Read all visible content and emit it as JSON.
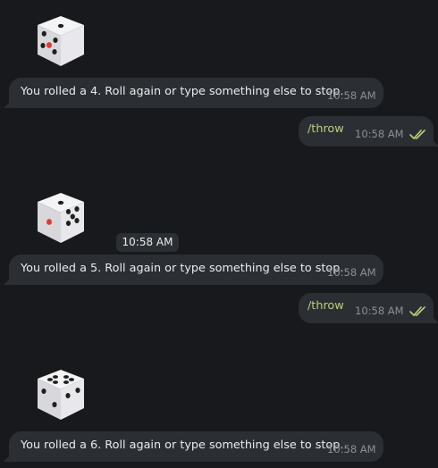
{
  "messages": [
    {
      "type": "dice",
      "face": 4,
      "text": "You rolled a 4. Roll again or type something else to stop.",
      "time": "10:58 AM"
    },
    {
      "type": "command",
      "text": "/throw",
      "time": "10:58 AM",
      "status": "read"
    },
    {
      "type": "dice",
      "face": 5,
      "text": "You rolled a 5. Roll again or type something else to stop.",
      "time": "10:58 AM"
    },
    {
      "type": "command",
      "text": "/throw",
      "time": "10:58 AM",
      "status": "read"
    },
    {
      "type": "dice",
      "face": 6,
      "text": "You rolled a 6. Roll again or type something else to stop.",
      "time": "10:58 AM"
    }
  ],
  "date_pill": "10:58 AM",
  "colors": {
    "background": "#17191c",
    "bubble": "#2b2f33",
    "text": "#e9ecef",
    "command_text": "#b9d17a",
    "time_text": "#8a9096",
    "read_ticks": "#b9d17a",
    "dice_pip_red": "#e53935",
    "dice_pip_dark": "#1f1f1f"
  },
  "icons": {
    "dice": "dice-icon",
    "read_ticks": "double-check-icon"
  }
}
